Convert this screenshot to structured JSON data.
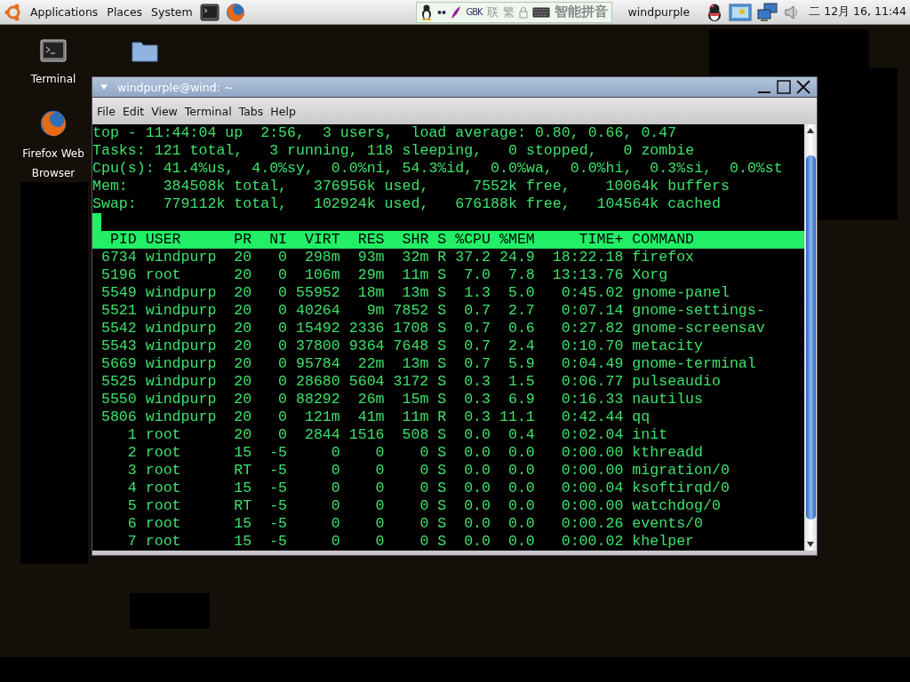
{
  "top_panel": {
    "menus": [
      "Applications",
      "Places",
      "System"
    ],
    "input_method": {
      "charset": "GBK",
      "toggles": [
        "联",
        "繁"
      ],
      "name": "智能拼音"
    },
    "user": "windpurple",
    "clock": "二 12月 16, 11:44"
  },
  "desktop_icons": [
    {
      "kind": "terminal",
      "label": "Terminal"
    },
    {
      "kind": "browser",
      "label": "Firefox Web Browser"
    },
    {
      "kind": "folder"
    }
  ],
  "terminal": {
    "title": "windpurple@wind: ~",
    "menu": [
      "File",
      "Edit",
      "View",
      "Terminal",
      "Tabs",
      "Help"
    ],
    "summary": [
      "top - 11:44:04 up  2:56,  3 users,  load average: 0.80, 0.66, 0.47",
      "Tasks: 121 total,   3 running, 118 sleeping,   0 stopped,   0 zombie",
      "Cpu(s): 41.4%us,  4.0%sy,  0.0%ni, 54.3%id,  0.0%wa,  0.0%hi,  0.3%si,  0.0%st",
      "Mem:    384508k total,   376956k used,     7552k free,    10064k buffers",
      "Swap:   779112k total,   102924k used,   676188k free,   104564k cached"
    ],
    "columns": [
      "PID",
      "USER",
      "PR",
      "NI",
      "VIRT",
      "RES",
      "SHR",
      "S",
      "%CPU",
      "%MEM",
      "TIME+",
      "COMMAND"
    ],
    "rows": [
      [
        "6734",
        "windpurp",
        "20",
        "0",
        "298m",
        "93m",
        "32m",
        "R",
        "37.2",
        "24.9",
        "18:22.18",
        "firefox"
      ],
      [
        "5196",
        "root",
        "20",
        "0",
        "106m",
        "29m",
        "11m",
        "S",
        "7.0",
        "7.8",
        "13:13.76",
        "Xorg"
      ],
      [
        "5549",
        "windpurp",
        "20",
        "0",
        "55952",
        "18m",
        "13m",
        "S",
        "1.3",
        "5.0",
        "0:45.02",
        "gnome-panel"
      ],
      [
        "5521",
        "windpurp",
        "20",
        "0",
        "40264",
        "9m",
        "7852",
        "S",
        "0.7",
        "2.7",
        "0:07.14",
        "gnome-settings-"
      ],
      [
        "5542",
        "windpurp",
        "20",
        "0",
        "15492",
        "2336",
        "1708",
        "S",
        "0.7",
        "0.6",
        "0:27.82",
        "gnome-screensav"
      ],
      [
        "5543",
        "windpurp",
        "20",
        "0",
        "37800",
        "9364",
        "7648",
        "S",
        "0.7",
        "2.4",
        "0:10.70",
        "metacity"
      ],
      [
        "5669",
        "windpurp",
        "20",
        "0",
        "95784",
        "22m",
        "13m",
        "S",
        "0.7",
        "5.9",
        "0:04.49",
        "gnome-terminal"
      ],
      [
        "5525",
        "windpurp",
        "20",
        "0",
        "28680",
        "5604",
        "3172",
        "S",
        "0.3",
        "1.5",
        "0:06.77",
        "pulseaudio"
      ],
      [
        "5550",
        "windpurp",
        "20",
        "0",
        "88292",
        "26m",
        "15m",
        "S",
        "0.3",
        "6.9",
        "0:16.33",
        "nautilus"
      ],
      [
        "5806",
        "windpurp",
        "20",
        "0",
        "121m",
        "41m",
        "11m",
        "R",
        "0.3",
        "11.1",
        "0:42.44",
        "qq"
      ],
      [
        "1",
        "root",
        "20",
        "0",
        "2844",
        "1516",
        "508",
        "S",
        "0.0",
        "0.4",
        "0:02.04",
        "init"
      ],
      [
        "2",
        "root",
        "15",
        "-5",
        "0",
        "0",
        "0",
        "S",
        "0.0",
        "0.0",
        "0:00.00",
        "kthreadd"
      ],
      [
        "3",
        "root",
        "RT",
        "-5",
        "0",
        "0",
        "0",
        "S",
        "0.0",
        "0.0",
        "0:00.00",
        "migration/0"
      ],
      [
        "4",
        "root",
        "15",
        "-5",
        "0",
        "0",
        "0",
        "S",
        "0.0",
        "0.0",
        "0:00.04",
        "ksoftirqd/0"
      ],
      [
        "5",
        "root",
        "RT",
        "-5",
        "0",
        "0",
        "0",
        "S",
        "0.0",
        "0.0",
        "0:00.00",
        "watchdog/0"
      ],
      [
        "6",
        "root",
        "15",
        "-5",
        "0",
        "0",
        "0",
        "S",
        "0.0",
        "0.0",
        "0:00.26",
        "events/0"
      ],
      [
        "7",
        "root",
        "15",
        "-5",
        "0",
        "0",
        "0",
        "S",
        "0.0",
        "0.0",
        "0:00.02",
        "khelper"
      ]
    ]
  }
}
